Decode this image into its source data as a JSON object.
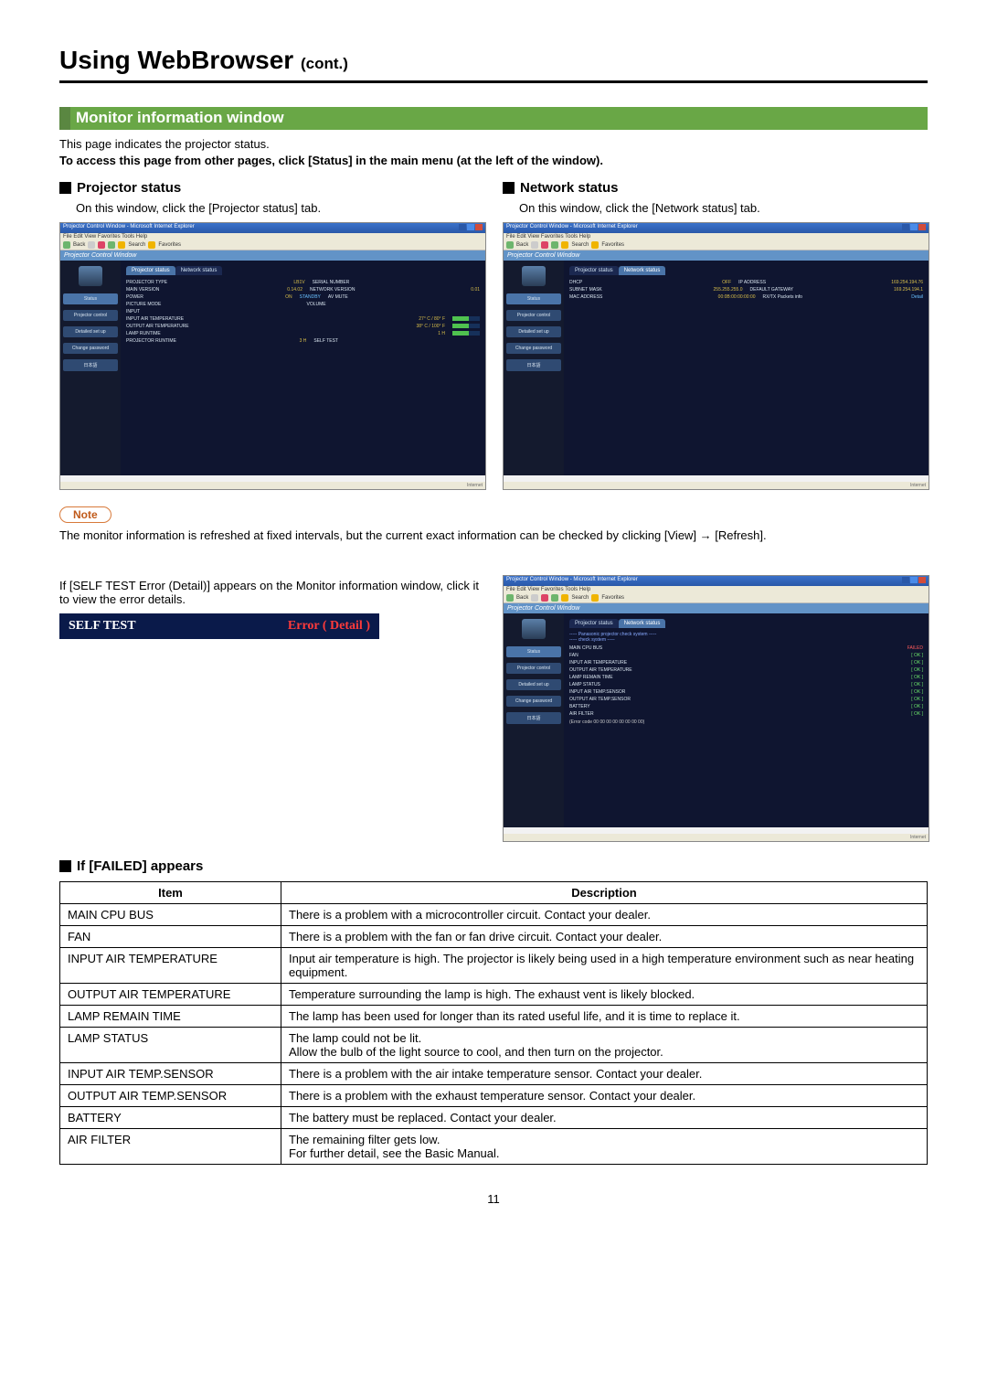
{
  "page": {
    "title_main": "Using WebBrowser",
    "title_cont": "(cont.)",
    "number": "11"
  },
  "section_banner": "Monitor information window",
  "intro": {
    "line1": "This page indicates the projector status.",
    "line2": "To access this page from other pages, click [Status] in the main menu (at the left of the window)."
  },
  "projector_status": {
    "heading": "Projector status",
    "caption": "On this window, click the [Projector status] tab."
  },
  "network_status": {
    "heading": "Network status",
    "caption": "On this window, click the [Network status] tab."
  },
  "browser": {
    "title": "Projector Control Window - Microsoft Internet Explorer",
    "menubar": "File  Edit  View  Favorites  Tools  Help",
    "pcw_title": "Projector Control Window",
    "side": {
      "status": "Status",
      "projector_control": "Projector control",
      "detailed_setup": "Detailed set up",
      "change_password": "Change password",
      "japanese": "日本語"
    },
    "tabs": {
      "projector_status": "Projector status",
      "network_status": "Network status"
    },
    "proj_fields": {
      "projector_type": "PROJECTOR TYPE",
      "projector_type_v": "LB1V",
      "serial_number": "SERIAL NUMBER",
      "main_version": "MAIN VERSION",
      "main_version_v": "0.14.02",
      "network_version": "NETWORK VERSION",
      "network_version_v": "0.01",
      "power": "POWER",
      "power_v": "ON",
      "standby": "STANDBY",
      "avmute": "AV MUTE",
      "picture_mode": "PICTURE MODE",
      "volume": "VOLUME",
      "input": "INPUT",
      "input_air_temp": "INPUT AIR TEMPERATURE",
      "input_air_temp_v": "27° C / 80° F",
      "output_air_temp": "OUTPUT AIR TEMPERATURE",
      "output_air_temp_v": "38° C / 100° F",
      "lamp_runtime": "LAMP RUNTIME",
      "lamp_runtime_v": "1 H",
      "projector_runtime": "PROJECTOR RUNTIME",
      "projector_runtime_v": "3 H",
      "self_test": "SELF TEST"
    },
    "net_fields": {
      "dhcp": "DHCP",
      "dhcp_v": "OFF",
      "ip_address": "IP ADDRESS",
      "ip_address_v": "169.254.194.76",
      "subnet_mask": "SUBNET MASK",
      "subnet_mask_v": "255.255.255.0",
      "default_gateway": "DEFAULT GATEWAY",
      "default_gateway_v": "169.254.194.1",
      "mac_address": "MAC ADDRESS",
      "mac_address_v": "00:0B:00:00:00:00",
      "rxtx": "RX/TX Packets info",
      "detail": "Detail"
    },
    "selftest": {
      "header": "----- Panasonic projector check system -----",
      "check": "----- check system -----",
      "rows": [
        {
          "k": "MAIN CPU BUS",
          "v": "FAILED",
          "fail": true
        },
        {
          "k": "FAN",
          "v": "[ OK ]"
        },
        {
          "k": "INPUT AIR TEMPERATURE",
          "v": "[ OK ]"
        },
        {
          "k": "OUTPUT AIR TEMPERATURE",
          "v": "[ OK ]"
        },
        {
          "k": "LAMP REMAIN TIME",
          "v": "[ OK ]"
        },
        {
          "k": "LAMP STATUS",
          "v": "[ OK ]"
        },
        {
          "k": "INPUT AIR TEMP.SENSOR",
          "v": "[ OK ]"
        },
        {
          "k": "OUTPUT AIR TEMP.SENSOR",
          "v": "[ OK ]"
        },
        {
          "k": "BATTERY",
          "v": "[ OK ]"
        },
        {
          "k": "AIR FILTER",
          "v": "[ OK ]"
        }
      ],
      "error_code": "(Error code 00 00 00 00 00 00 00 00)"
    }
  },
  "note": {
    "label": "Note",
    "text": "The monitor information is refreshed at fixed intervals, but the current exact information can be checked by clicking [View] → [Refresh]."
  },
  "selftest_para": "If [SELF TEST Error (Detail)] appears on the Monitor information window, click it to view the error details.",
  "selftest_bar": {
    "label": "SELF TEST",
    "error": "Error ( Detail )"
  },
  "failed": {
    "heading": "If [FAILED] appears",
    "col_item": "Item",
    "col_desc": "Description",
    "rows": [
      {
        "item": "MAIN CPU BUS",
        "desc": "There is a problem with a microcontroller circuit. Contact your dealer."
      },
      {
        "item": "FAN",
        "desc": "There is a problem with the fan or fan drive circuit. Contact your dealer."
      },
      {
        "item": "INPUT AIR TEMPERATURE",
        "desc": "Input air temperature is high. The projector is likely being used in a high temperature environment such as near heating equipment."
      },
      {
        "item": "OUTPUT AIR TEMPERATURE",
        "desc": "Temperature surrounding the lamp is high. The exhaust vent is likely blocked."
      },
      {
        "item": "LAMP REMAIN TIME",
        "desc": "The lamp has been used for longer than its rated useful life, and it is time to replace it."
      },
      {
        "item": "LAMP STATUS",
        "desc": "The lamp could not be lit.\nAllow the bulb of the light source to cool, and then turn on the projector."
      },
      {
        "item": "INPUT AIR TEMP.SENSOR",
        "desc": "There is a problem with the air intake temperature sensor. Contact your dealer."
      },
      {
        "item": "OUTPUT AIR TEMP.SENSOR",
        "desc": "There is a problem with the exhaust temperature sensor. Contact your dealer."
      },
      {
        "item": "BATTERY",
        "desc": "The battery must be replaced. Contact your dealer."
      },
      {
        "item": "AIR FILTER",
        "desc": "The remaining filter gets low.\nFor further detail, see the Basic Manual."
      }
    ]
  }
}
